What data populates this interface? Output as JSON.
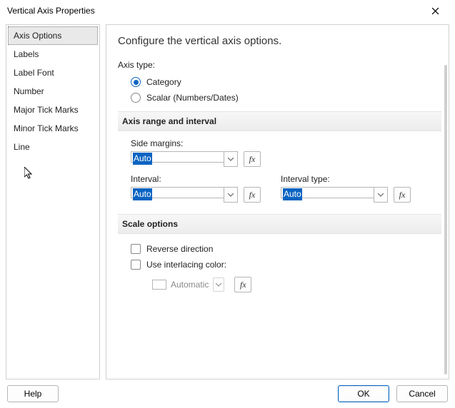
{
  "window": {
    "title": "Vertical Axis Properties"
  },
  "sidebar": {
    "items": [
      {
        "label": "Axis Options",
        "selected": true
      },
      {
        "label": "Labels"
      },
      {
        "label": "Label Font"
      },
      {
        "label": "Number"
      },
      {
        "label": "Major Tick Marks"
      },
      {
        "label": "Minor Tick Marks"
      },
      {
        "label": "Line"
      }
    ]
  },
  "main": {
    "heading": "Configure the vertical axis options.",
    "axis_type": {
      "label": "Axis type:",
      "options": [
        {
          "label": "Category",
          "checked": true
        },
        {
          "label": "Scalar (Numbers/Dates)",
          "checked": false
        }
      ]
    },
    "range_section": {
      "title": "Axis range and interval",
      "side_margins": {
        "label": "Side margins:",
        "value": "Auto"
      },
      "interval": {
        "label": "Interval:",
        "value": "Auto"
      },
      "interval_type": {
        "label": "Interval type:",
        "value": "Auto"
      }
    },
    "scale_section": {
      "title": "Scale options",
      "reverse": {
        "label": "Reverse direction",
        "checked": false
      },
      "interlace": {
        "label": "Use interlacing color:",
        "checked": false
      },
      "interlace_color": {
        "label": "Automatic"
      }
    },
    "fx_label": "fx"
  },
  "footer": {
    "help": "Help",
    "ok": "OK",
    "cancel": "Cancel"
  }
}
